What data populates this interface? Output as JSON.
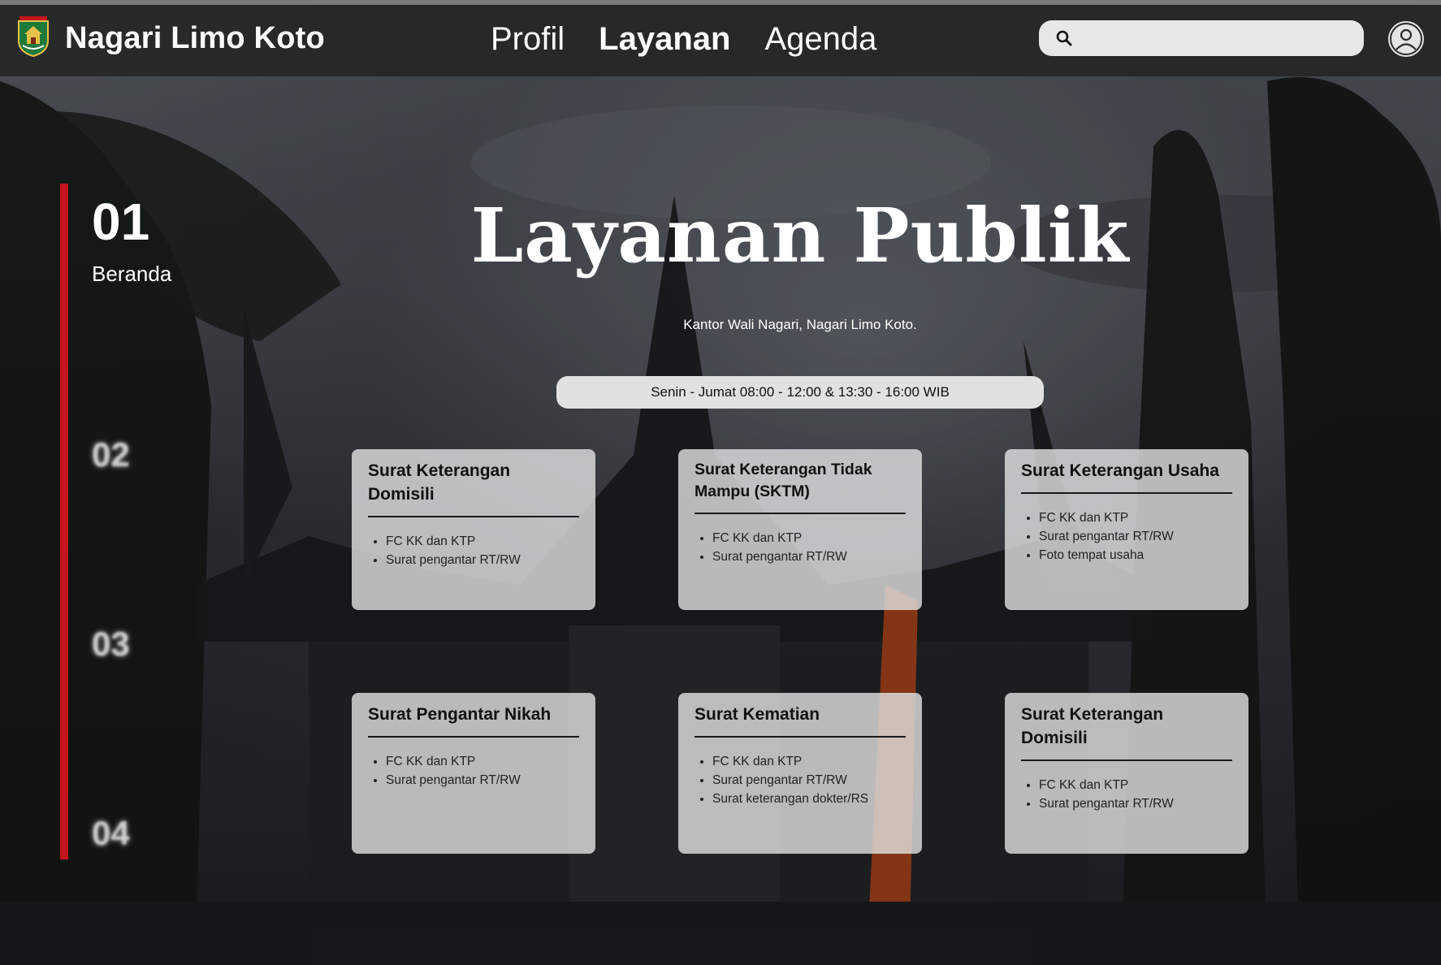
{
  "header": {
    "brand": "Nagari Limo Koto",
    "nav": [
      {
        "label": "Profil",
        "active": false
      },
      {
        "label": "Layanan",
        "active": true
      },
      {
        "label": "Agenda",
        "active": false
      }
    ],
    "search": {
      "placeholder": "",
      "value": ""
    },
    "icons": {
      "search": "search-icon",
      "avatar": "user-avatar-icon",
      "logo": "nagari-emblem"
    }
  },
  "timeline": {
    "accent_color": "#c4161c",
    "active": {
      "number": "01",
      "label": "Beranda"
    },
    "others": [
      "02",
      "03",
      "04"
    ]
  },
  "hero": {
    "title": "Layanan Publik",
    "subtitle": "Kantor Wali Nagari, Nagari Limo Koto.",
    "hours": "Senin - Jumat 08:00 - 12:00 & 13:30 - 16:00 WIB"
  },
  "cards": [
    {
      "title": "Surat Keterangan Domisili",
      "items": [
        "FC KK dan KTP",
        "Surat pengantar RT/RW"
      ]
    },
    {
      "title": "Surat Keterangan Tidak Mampu (SKTM)",
      "items": [
        "FC KK dan KTP",
        "Surat pengantar RT/RW"
      ]
    },
    {
      "title": "Surat Keterangan Usaha",
      "items": [
        "FC KK dan KTP",
        "Surat pengantar RT/RW",
        "Foto tempat usaha"
      ]
    },
    {
      "title": "Surat Pengantar Nikah",
      "items": [
        "FC KK dan KTP",
        "Surat pengantar RT/RW"
      ]
    },
    {
      "title": "Surat Kematian",
      "items": [
        "FC KK dan KTP",
        "Surat pengantar RT/RW",
        "Surat keterangan dokter/RS"
      ]
    },
    {
      "title": "Surat Keterangan Domisili",
      "items": [
        "FC KK dan KTP",
        "Surat pengantar RT/RW"
      ]
    }
  ]
}
